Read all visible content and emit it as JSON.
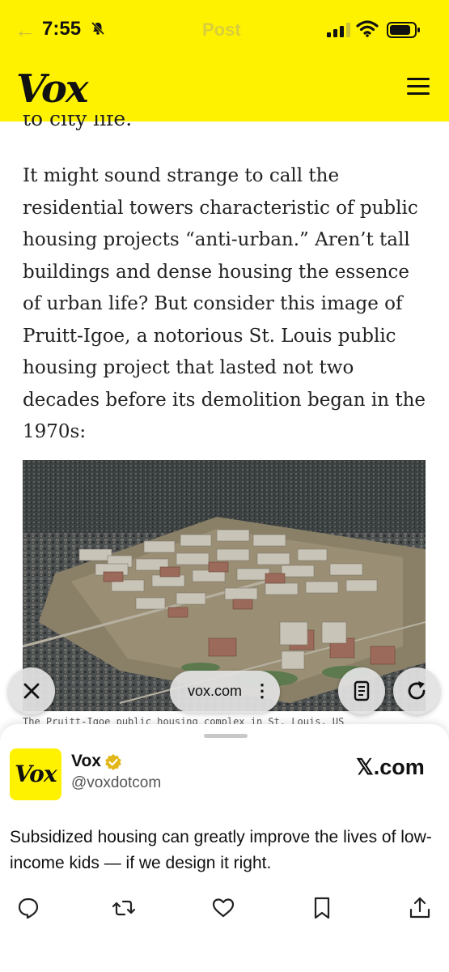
{
  "status_bar": {
    "time": "7:55",
    "title": "Post",
    "icons": [
      "back-arrow-icon",
      "bell-slash-icon",
      "signal-icon",
      "wifi-icon",
      "battery-icon"
    ]
  },
  "header": {
    "logo": "Vox",
    "menu_icon": "hamburger-menu-icon",
    "background": "#fff200"
  },
  "article": {
    "clipped_line": "to city life.",
    "paragraph": "It might sound strange to call the residential towers characteristic of public housing projects “anti-urban.” Aren’t tall buildings and dense housing the essence of urban life? But consider this image of Pruitt-Igoe, a notorious St. Louis public housing project that lasted not two decades before its demolition began in the 1970s:",
    "image_caption": "The Pruitt-Igoe public housing complex in St. Louis, US"
  },
  "browser_controls": {
    "url": "vox.com",
    "more": "⋮",
    "buttons": [
      "close-icon",
      "reader-icon",
      "reload-icon"
    ]
  },
  "share_card": {
    "avatar_logo": "Vox",
    "account_name": "Vox",
    "handle": "@voxdotcom",
    "source": "𝕏.com",
    "tweet_text": "Subsidized housing can greatly improve the lives of low-income kids — if we design it right.",
    "actions": [
      "reply-icon",
      "retweet-icon",
      "like-icon",
      "bookmark-icon",
      "share-icon"
    ],
    "verified_color": "#e2b719"
  }
}
